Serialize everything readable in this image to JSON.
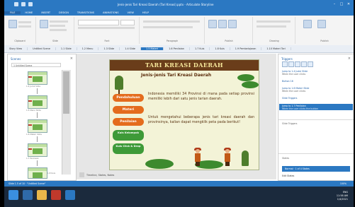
{
  "window": {
    "title": "Jenis-jenis Tari Kreasi Daerah (Tari Kreasi).pptx - Articulate Storyline",
    "minimize": "–",
    "maximize": "□",
    "close": "✕"
  },
  "ribbon_tabs": [
    "FILE",
    "HOME",
    "INSERT",
    "DESIGN",
    "TRANSITIONS",
    "ANIMATIONS",
    "VIEW",
    "HELP"
  ],
  "ribbon_groups": [
    {
      "label": "Clipboard"
    },
    {
      "label": "Slide"
    },
    {
      "label": "Font"
    },
    {
      "label": "Paragraph"
    },
    {
      "label": "Publish"
    },
    {
      "label": "Drawing"
    },
    {
      "label": "Publish"
    }
  ],
  "doc_tabs": [
    "Story View",
    "Untitled Scene",
    "1.1 Slide",
    "1.2 Menu",
    "1.3 Slide",
    "1.4 Slide",
    "1.5 Materi",
    "1.6 Penilaian",
    "1.7 Kuis",
    "1.8 Kuis",
    "1.9 Pembelajaran",
    "1.10 Materi Tari"
  ],
  "active_doc_tab": "1.5 Materi",
  "left_panel": {
    "title": "Scenes",
    "close": "×",
    "search": "1 Untitled Scene",
    "slides": [
      {
        "caption": "1.4 Judul Slide"
      },
      {
        "caption": "1.5 Menu Slide"
      },
      {
        "caption": "1.6 Materi Slide"
      },
      {
        "caption": "1.7 Penilaian"
      },
      {
        "caption": "1.8 Kuis"
      }
    ]
  },
  "slide": {
    "title": "TARI KREASI DAERAH",
    "subtitle": "Jenis-jenis Tari Kreasi Daerah",
    "paragraph1": "Indonesia memiliki 34 Provinsi di mana pada setiap provinsi memiliki lebih dari satu jenis tarian daerah.",
    "paragraph2": "Untuk mengetahui beberapa jenis tari kreasi daerah dan provinsinya, kalian dapat mengklik peta pada berikut!",
    "menu": [
      "Pendahuluan",
      "Materi",
      "Penilaian",
      "Kuis Kelompok",
      "Kuis Click & Drop"
    ]
  },
  "canvas_footer": "Timeline, States, Notes",
  "right_panel": {
    "title": "Triggers",
    "close": "×",
    "triggers": [
      {
        "text": "Jump to 1.4 Judul Slide",
        "sub": "When the user clicks"
      },
      {
        "text": "Button 16",
        "sub": ""
      },
      {
        "text": "Jump to 1.6 Materi Slide",
        "sub": "When the user clicks"
      },
      {
        "text": "Slide Triggers",
        "sub": ""
      },
      {
        "text": "Jump to 1.7 Penilaian",
        "sub": "When the user clicks the button"
      }
    ],
    "section2": "Slide Triggers",
    "state_bar": "States",
    "state_selected": "Normal · 1 of 4 States",
    "player": "Edit States"
  },
  "status": {
    "text": "Slide 1.5 of 10 · \"Untitled Scene\"",
    "zoom": "100%"
  },
  "taskbar": {
    "time": "11:58 AM",
    "date": "1/4/2021",
    "lang": "ENG"
  },
  "colors": {
    "accent": "#2b78c2",
    "slide_title_bg": "#6a3d1a",
    "menu_orange": "#e46c1d",
    "menu_green": "#3e9a38"
  }
}
